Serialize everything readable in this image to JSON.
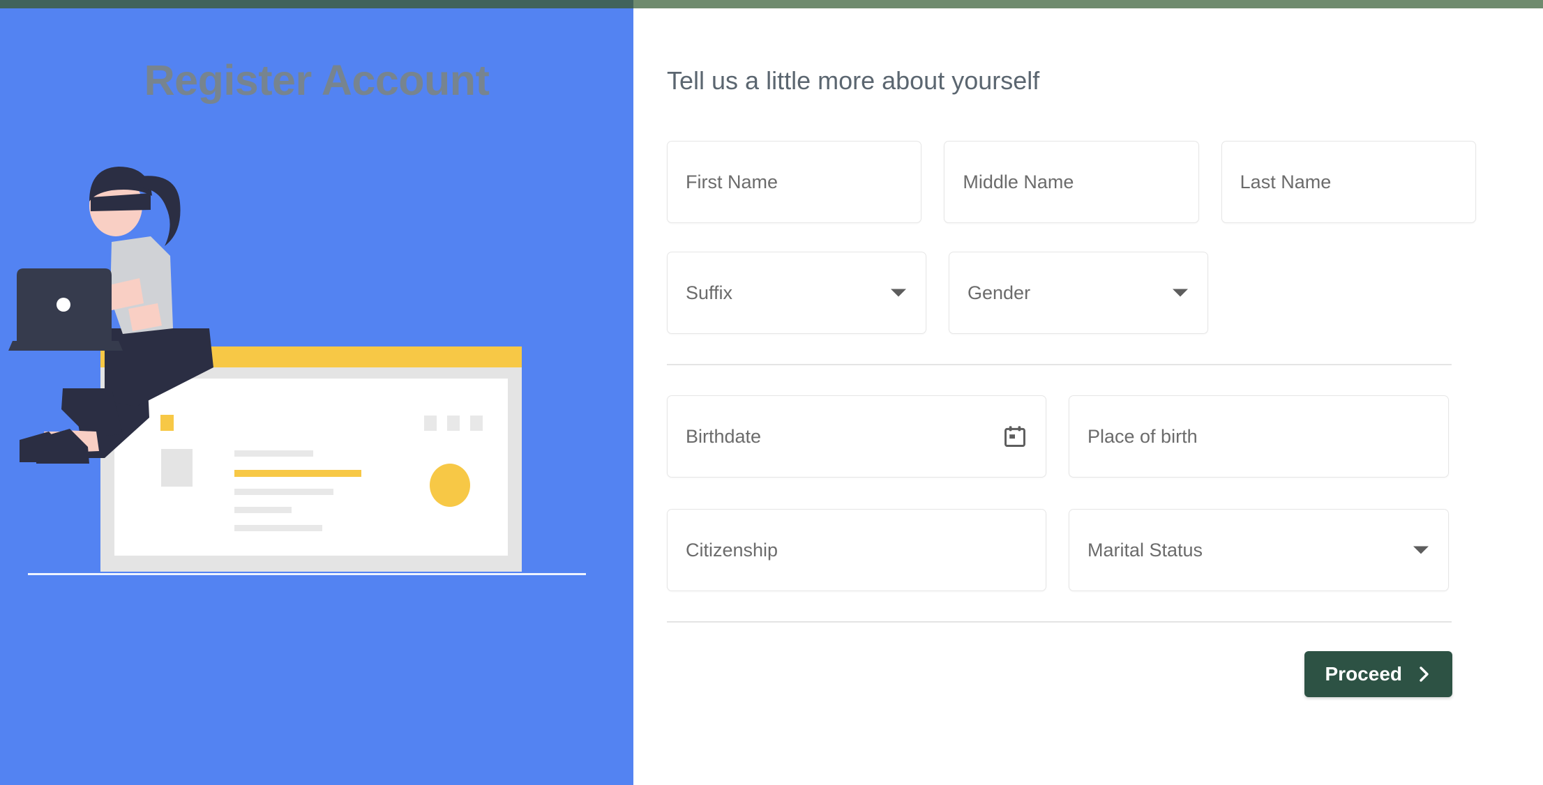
{
  "topbar": {
    "left_color": "#41635c",
    "right_color": "#6f8b6e"
  },
  "left_panel": {
    "background_color": "#5383f2",
    "title": "Register Account",
    "title_color": "#77848f",
    "illustration": {
      "name": "woman-with-laptop-and-browser-window",
      "accent_color": "#f7c846",
      "skin_color": "#f9cfc4",
      "hair_color": "#2b2e43",
      "shirt_color": "#d0d2d6",
      "pants_color": "#2b2e43"
    }
  },
  "form": {
    "heading": "Tell us a little more about yourself",
    "heading_color": "#5b6670",
    "fields": {
      "first_name": {
        "label": "First Name",
        "type": "text"
      },
      "middle_name": {
        "label": "Middle Name",
        "type": "text"
      },
      "last_name": {
        "label": "Last Name",
        "type": "text"
      },
      "suffix": {
        "label": "Suffix",
        "type": "select"
      },
      "gender": {
        "label": "Gender",
        "type": "select"
      },
      "birthdate": {
        "label": "Birthdate",
        "type": "date"
      },
      "place_of_birth": {
        "label": "Place of birth",
        "type": "text"
      },
      "citizenship": {
        "label": "Citizenship",
        "type": "text"
      },
      "marital_status": {
        "label": "Marital Status",
        "type": "select"
      }
    },
    "icons": {
      "birthdate": "calendar-icon",
      "suffix": "chevron-down-icon",
      "gender": "chevron-down-icon",
      "marital_status": "chevron-down-icon"
    },
    "submit": {
      "label": "Proceed",
      "icon": "chevron-right-icon",
      "background_color": "#2d5244",
      "text_color": "#ffffff"
    }
  }
}
